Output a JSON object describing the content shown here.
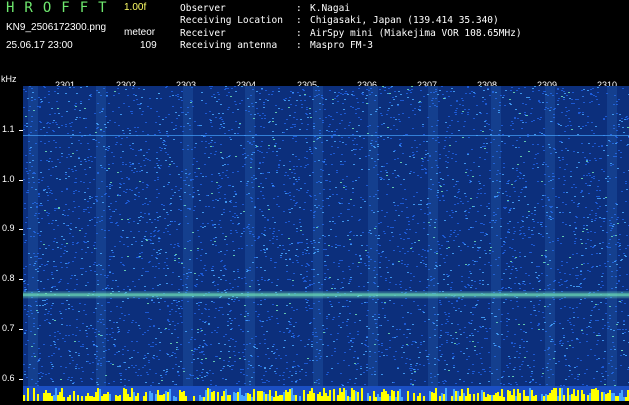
{
  "header": {
    "brand": "HROFFT",
    "version": "1.00f",
    "file_name": "KN9_2506172300.png",
    "mode": "meteor",
    "datetime": "25.06.17 23:00",
    "count": "109"
  },
  "info": [
    {
      "key": "Observer",
      "value": "K.Nagai"
    },
    {
      "key": "Receiving Location",
      "value": "Chigasaki, Japan (139.414 35.340)"
    },
    {
      "key": "Receiver",
      "value": "AirSpy mini (Miakejima VOR 108.65MHz)"
    },
    {
      "key": "Receiving antenna",
      "value": "Maspro FM-3"
    }
  ],
  "axes": {
    "y_unit": "kHz",
    "y_ticks": [
      "1.1",
      "1.0",
      "0.9",
      "0.8",
      "0.7",
      "0.6"
    ],
    "time_ticks": [
      "2301",
      "2302",
      "2303",
      "2304",
      "2305",
      "2306",
      "2307",
      "2308",
      "2309",
      "2310"
    ]
  },
  "spectrogram": {
    "carrier_khz": 0.77,
    "faint_line_khz": 1.09,
    "colors": {
      "background": "#0c2f7c",
      "noise": "#1f5fe0",
      "bright_noise": "#46a4ff",
      "carrier": "#6fe0b8",
      "signal_bar": "#ffff00",
      "bottom_bar": "#1b4fc3"
    }
  }
}
